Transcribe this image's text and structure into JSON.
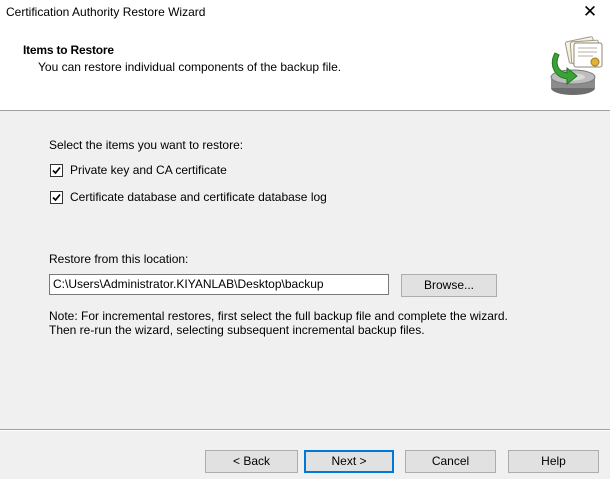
{
  "window": {
    "title": "Certification Authority Restore Wizard",
    "close_glyph": "✕"
  },
  "header": {
    "title": "Items to Restore",
    "subtitle": "You can restore individual components of the backup file.",
    "icon": "restore-backup-icon"
  },
  "items": {
    "prompt": "Select the items you want to restore:",
    "options": [
      {
        "label": "Private key and CA certificate",
        "checked": true
      },
      {
        "label": "Certificate database and certificate database log",
        "checked": true
      }
    ]
  },
  "location": {
    "label": "Restore from this location:",
    "path": "C:\\Users\\Administrator.KIYANLAB\\Desktop\\backup",
    "browse_label": "Browse..."
  },
  "note": {
    "line1": "Note: For incremental restores, first select the full backup file and complete the wizard.",
    "line2": "Then re-run the wizard, selecting subsequent incremental backup files."
  },
  "buttons": {
    "back": "< Back",
    "next": "Next >",
    "cancel": "Cancel",
    "help": "Help"
  },
  "colors": {
    "dialog_bg": "#f0f0f0",
    "header_bg": "#ffffff",
    "button_bg": "#e1e1e1",
    "focus_accent": "#0078d7"
  }
}
